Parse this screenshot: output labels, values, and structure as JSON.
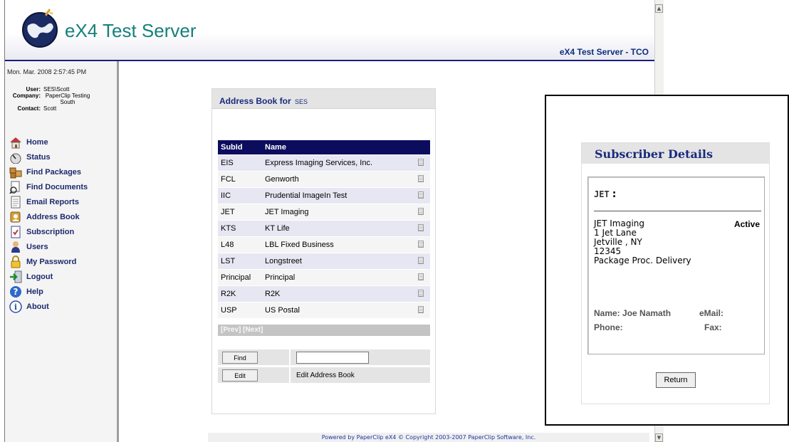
{
  "app": {
    "title": "eX4 Test Server",
    "subtitle": "eX4 Test Server - TCO"
  },
  "session": {
    "datetime": "Mon. Mar. 2008 2:57:45 PM",
    "user_label": "User:",
    "user": "SES\\Scott",
    "company_label": "Company:",
    "company": "PaperClip Testing South",
    "contact_label": "Contact:",
    "contact": "Scott"
  },
  "nav": [
    {
      "label": "Home",
      "icon": "home-icon"
    },
    {
      "label": "Status",
      "icon": "status-icon"
    },
    {
      "label": "Find Packages",
      "icon": "packages-icon"
    },
    {
      "label": "Find Documents",
      "icon": "documents-icon"
    },
    {
      "label": "Email Reports",
      "icon": "email-icon"
    },
    {
      "label": "Address Book",
      "icon": "address-book-icon"
    },
    {
      "label": "Subscription",
      "icon": "subscription-icon"
    },
    {
      "label": "Users",
      "icon": "users-icon"
    },
    {
      "label": "My Password",
      "icon": "lock-icon"
    },
    {
      "label": "Logout",
      "icon": "logout-icon"
    },
    {
      "label": "Help",
      "icon": "help-icon"
    },
    {
      "label": "About",
      "icon": "info-icon"
    }
  ],
  "address_book": {
    "title": "Address Book for",
    "client": "SES",
    "columns": [
      "SubId",
      "Name"
    ],
    "rows": [
      {
        "subid": "EIS",
        "name": "Express Imaging Services, Inc."
      },
      {
        "subid": "FCL",
        "name": "Genworth"
      },
      {
        "subid": "IIC",
        "name": "Prudential ImageIn Test"
      },
      {
        "subid": "JET",
        "name": "JET Imaging"
      },
      {
        "subid": "KTS",
        "name": "KT Life"
      },
      {
        "subid": "L48",
        "name": "LBL Fixed Business"
      },
      {
        "subid": "LST",
        "name": "Longstreet"
      },
      {
        "subid": "Principal",
        "name": "Principal"
      },
      {
        "subid": "R2K",
        "name": "R2K"
      },
      {
        "subid": "USP",
        "name": "US Postal"
      }
    ],
    "pager": "[Prev] [Next]",
    "find_label": "Find",
    "find_value": "",
    "edit_label": "Edit",
    "edit_desc": "Edit Address Book"
  },
  "footer": "Powered by PaperClip eX4 © Copyright 2003-2007 PaperClip Software, Inc.",
  "subscriber": {
    "title": "Subscriber Details",
    "code": "JET",
    "colon": ":",
    "company": "JET Imaging",
    "status": "Active",
    "address1": "1 Jet Lane",
    "city_state": "Jetville , NY",
    "zip": "12345",
    "delivery": "Package Proc. Delivery",
    "name_label": "Name:",
    "name": "Joe Namath",
    "phone_label": "Phone:",
    "email_label": "eMail:",
    "fax_label": "Fax:",
    "return_label": "Return"
  }
}
